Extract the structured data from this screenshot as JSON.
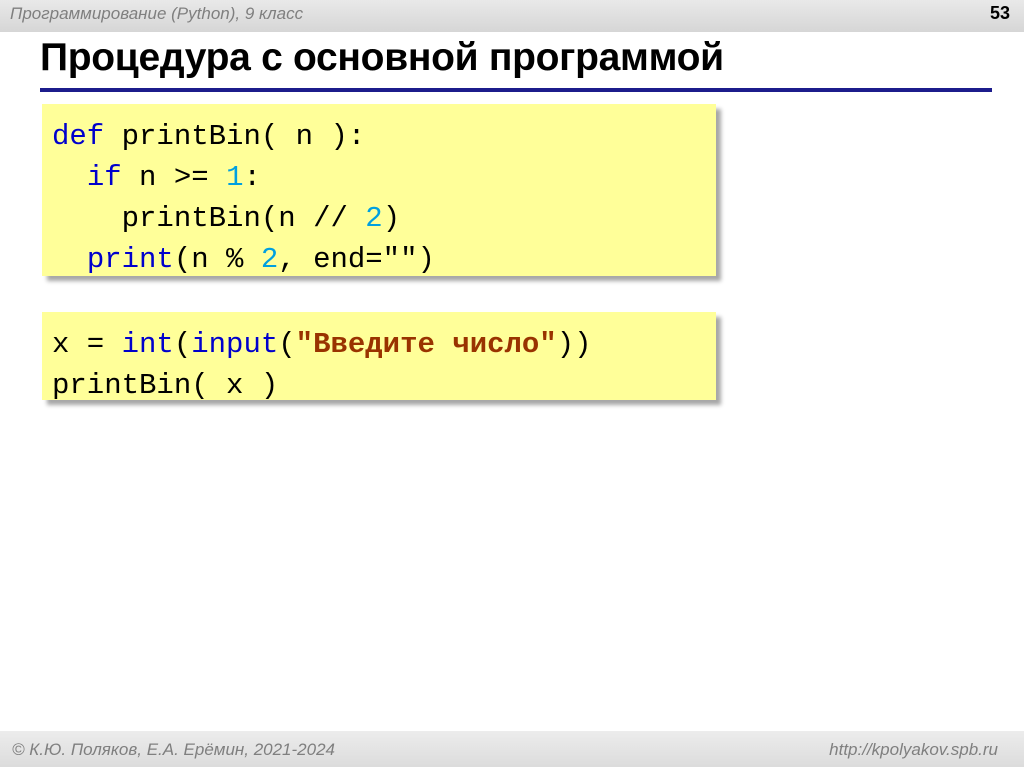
{
  "header": {
    "subject": "Программирование (Python), 9 класс",
    "page_number": "53"
  },
  "title": "Процедура с основной программой",
  "code_proc": {
    "l1_def": "def",
    "l1_rest": " printBin( n ):",
    "l2_if": "if",
    "l2_mid": " n ",
    "l2_op": ">=",
    "l2_sp": " ",
    "l2_num": "1",
    "l2_end": ":",
    "l3_call": "printBin(n ",
    "l3_op": "//",
    "l3_sp": " ",
    "l3_num": "2",
    "l3_end": ")",
    "l4_print": "print",
    "l4_mid": "(n ",
    "l4_op": "%",
    "l4_sp": " ",
    "l4_num": "2",
    "l4_rest": ", end=\"\")"
  },
  "code_main": {
    "l1_pre": "x = ",
    "l1_int": "int",
    "l1_p1": "(",
    "l1_input": "input",
    "l1_p2": "(",
    "l1_str": "\"Введите число\"",
    "l1_end": "))",
    "l2": "printBin( x )"
  },
  "footer": {
    "authors": "© К.Ю. Поляков, Е.А. Ерёмин, 2021-2024",
    "url": "http://kpolyakov.spb.ru"
  },
  "colors": {
    "keyword": "#0000cc",
    "number": "#00a0e0",
    "string": "#993300",
    "code_background": "#ffff99",
    "title_rule": "#1c1c8c"
  }
}
